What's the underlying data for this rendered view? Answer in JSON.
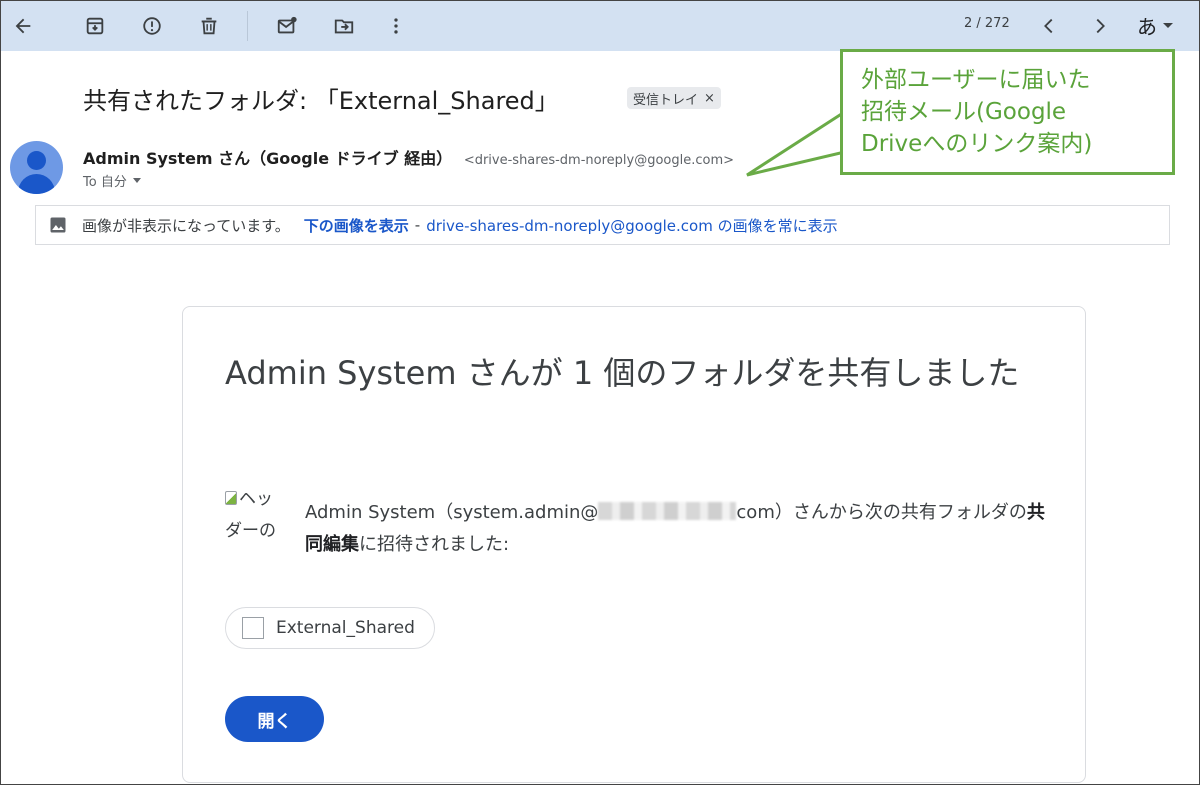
{
  "toolbar": {
    "icons": [
      "back-arrow-icon",
      "archive-icon",
      "report-spam-icon",
      "delete-icon",
      "mark-unread-icon",
      "move-to-icon",
      "more-vert-icon",
      "chevron-left-icon",
      "chevron-right-icon"
    ],
    "pager": "2 / 272",
    "ime_label": "あ"
  },
  "message": {
    "subject": "共有されたフォルダ: 「External_Shared」",
    "label": "受信トレイ",
    "label_close": "×",
    "sender_name": "Admin System さん（Google ドライブ 経由）",
    "sender_email": "<drive-shares-dm-noreply@google.com>",
    "to_line": "To 自分"
  },
  "images_bar": {
    "text": "画像が非表示になっています。",
    "show_link": "下の画像を表示",
    "dash": "-",
    "always_link": "drive-shares-dm-noreply@google.com の画像を常に表示"
  },
  "callout": {
    "line1": "外部ユーザーに届いた",
    "line2": "招待メール(Google",
    "line3": "Driveへのリンク案内)",
    "color": "#6aab47"
  },
  "card": {
    "title": "Admin System さんが 1 個のフォルダを共有しました",
    "broken_image_alt": "ヘッダーの",
    "invite_prefix": "Admin System（system.admin@",
    "invite_domain_suffix": "com）さんから次の共有フォルダの",
    "invite_bold": "共同編集",
    "invite_suffix": "に招待されました:",
    "folder_name": "External_Shared",
    "open_button": "開く",
    "accent": "#1a57c9"
  }
}
